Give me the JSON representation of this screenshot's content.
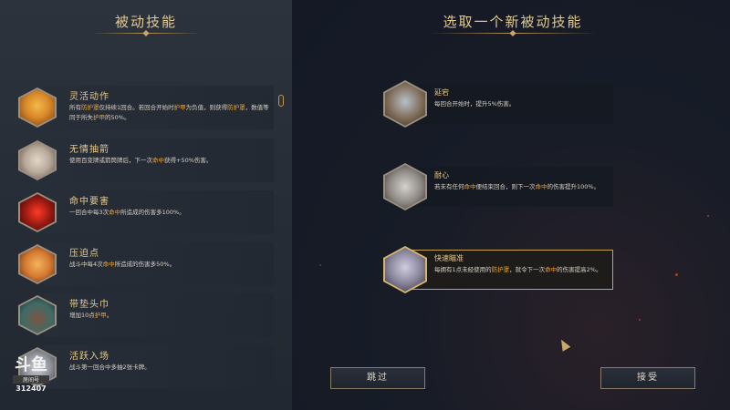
{
  "left_panel": {
    "title": "被动技能"
  },
  "right_panel": {
    "title": "选取一个新被动技能"
  },
  "owned_skills": [
    {
      "icon": "acrobat-icon",
      "name": "灵活动作",
      "desc": [
        [
          "所有",
          ""
        ],
        [
          "防护罩",
          "kw"
        ],
        [
          "仅持续1回合。若回合开始时",
          ""
        ],
        [
          "护甲",
          "kw"
        ],
        [
          "为负值，则获得",
          ""
        ],
        [
          "防护罩",
          "kw"
        ],
        [
          "，数值等同于所失",
          ""
        ],
        [
          "护甲",
          "kw"
        ],
        [
          "的50%。",
          ""
        ]
      ]
    },
    {
      "icon": "arrow-icon",
      "name": "无情抽箭",
      "desc": [
        [
          "使用百变牌或箭筒牌后，下一次",
          ""
        ],
        [
          "命中",
          "kw"
        ],
        [
          "获得+50%伤害。",
          ""
        ]
      ]
    },
    {
      "icon": "vital-strike-icon",
      "name": "命中要害",
      "desc": [
        [
          "一回合中每3次",
          ""
        ],
        [
          "命中",
          "kw"
        ],
        [
          "所造成的伤害多100%。",
          ""
        ]
      ]
    },
    {
      "icon": "pressure-point-icon",
      "name": "压迫点",
      "desc": [
        [
          "战斗中每4次",
          ""
        ],
        [
          "命中",
          "kw"
        ],
        [
          "所造成的伤害多50%。",
          ""
        ]
      ]
    },
    {
      "icon": "headband-icon",
      "name": "带垫头巾",
      "desc": [
        [
          "增加10点",
          ""
        ],
        [
          "护甲",
          "kw"
        ],
        [
          "。",
          ""
        ]
      ]
    },
    {
      "icon": "agile-entry-icon",
      "name": "活跃入场",
      "desc": [
        [
          "战斗第一回合中多抽2张卡牌。",
          ""
        ]
      ]
    }
  ],
  "choices": [
    {
      "icon": "delay-icon",
      "name": "延宕",
      "selected": false,
      "desc": [
        [
          "每回合开始时，提升5%伤害。",
          ""
        ]
      ]
    },
    {
      "icon": "patience-icon",
      "name": "耐心",
      "selected": false,
      "desc": [
        [
          "若未有任何",
          ""
        ],
        [
          "命中",
          "kw"
        ],
        [
          "便结束回合，则下一次",
          ""
        ],
        [
          "命中",
          "kw"
        ],
        [
          "的伤害提升100%。",
          ""
        ]
      ]
    },
    {
      "icon": "quick-aim-icon",
      "name": "快速瞄准",
      "selected": true,
      "desc": [
        [
          "每拥有1点未经使用的",
          ""
        ],
        [
          "防护罩",
          "kw"
        ],
        [
          "，就令下一次",
          ""
        ],
        [
          "命中",
          "kw"
        ],
        [
          "的伤害提高2%。",
          ""
        ]
      ]
    }
  ],
  "buttons": {
    "skip": "跳过",
    "accept": "接受"
  },
  "watermark": {
    "logo": "斗鱼",
    "sub": "房间号",
    "room": "312407"
  },
  "colors": {
    "accent_gold": "#e7c98a",
    "keyword": "#e8a43c",
    "selected_border": "#c9a24e"
  }
}
